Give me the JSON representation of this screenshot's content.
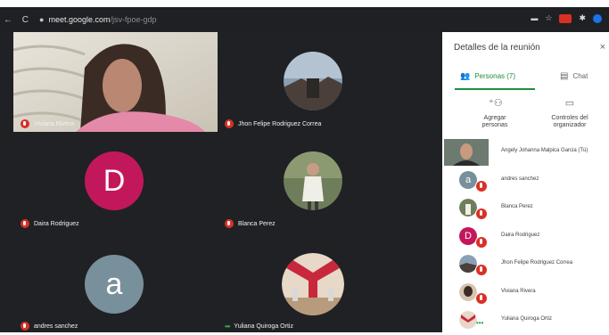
{
  "browser": {
    "back": "←",
    "reload": "C",
    "url_host": "meet.google.com",
    "url_path": "/jsv-fpoe-gdp"
  },
  "tiles": [
    {
      "name": "Viviana Rivera",
      "status": "muted"
    },
    {
      "name": "Jhon Felipe Rodriguez Correa",
      "status": "muted"
    },
    {
      "name": "Daira Rodriguez",
      "status": "muted",
      "initial": "D",
      "color": "#c2185b"
    },
    {
      "name": "Blanca Perez",
      "status": "muted"
    },
    {
      "name": "andres sanchez",
      "status": "muted",
      "initial": "a",
      "color": "#78909c"
    },
    {
      "name": "Yuliana Quiroga Ortiz",
      "status": "speaking"
    }
  ],
  "panel": {
    "title": "Detalles de la reunión",
    "close": "×",
    "tab_people": "Personas (7)",
    "tab_chat": "Chat",
    "add_people": [
      "Agregar",
      "personas"
    ],
    "host_controls": [
      "Controles del",
      "organizador"
    ]
  },
  "participants": [
    {
      "name": "Angely Johanna Malpica Garcia (Tú)"
    },
    {
      "name": "andres sanchez",
      "initial": "a"
    },
    {
      "name": "Blanca Perez"
    },
    {
      "name": "Daira Rodriguez",
      "initial": "D"
    },
    {
      "name": "Jhon Felipe Rodriguez Correa"
    },
    {
      "name": "Viviana Rivera"
    },
    {
      "name": "Yuliana Quiroga Ortiz"
    }
  ]
}
